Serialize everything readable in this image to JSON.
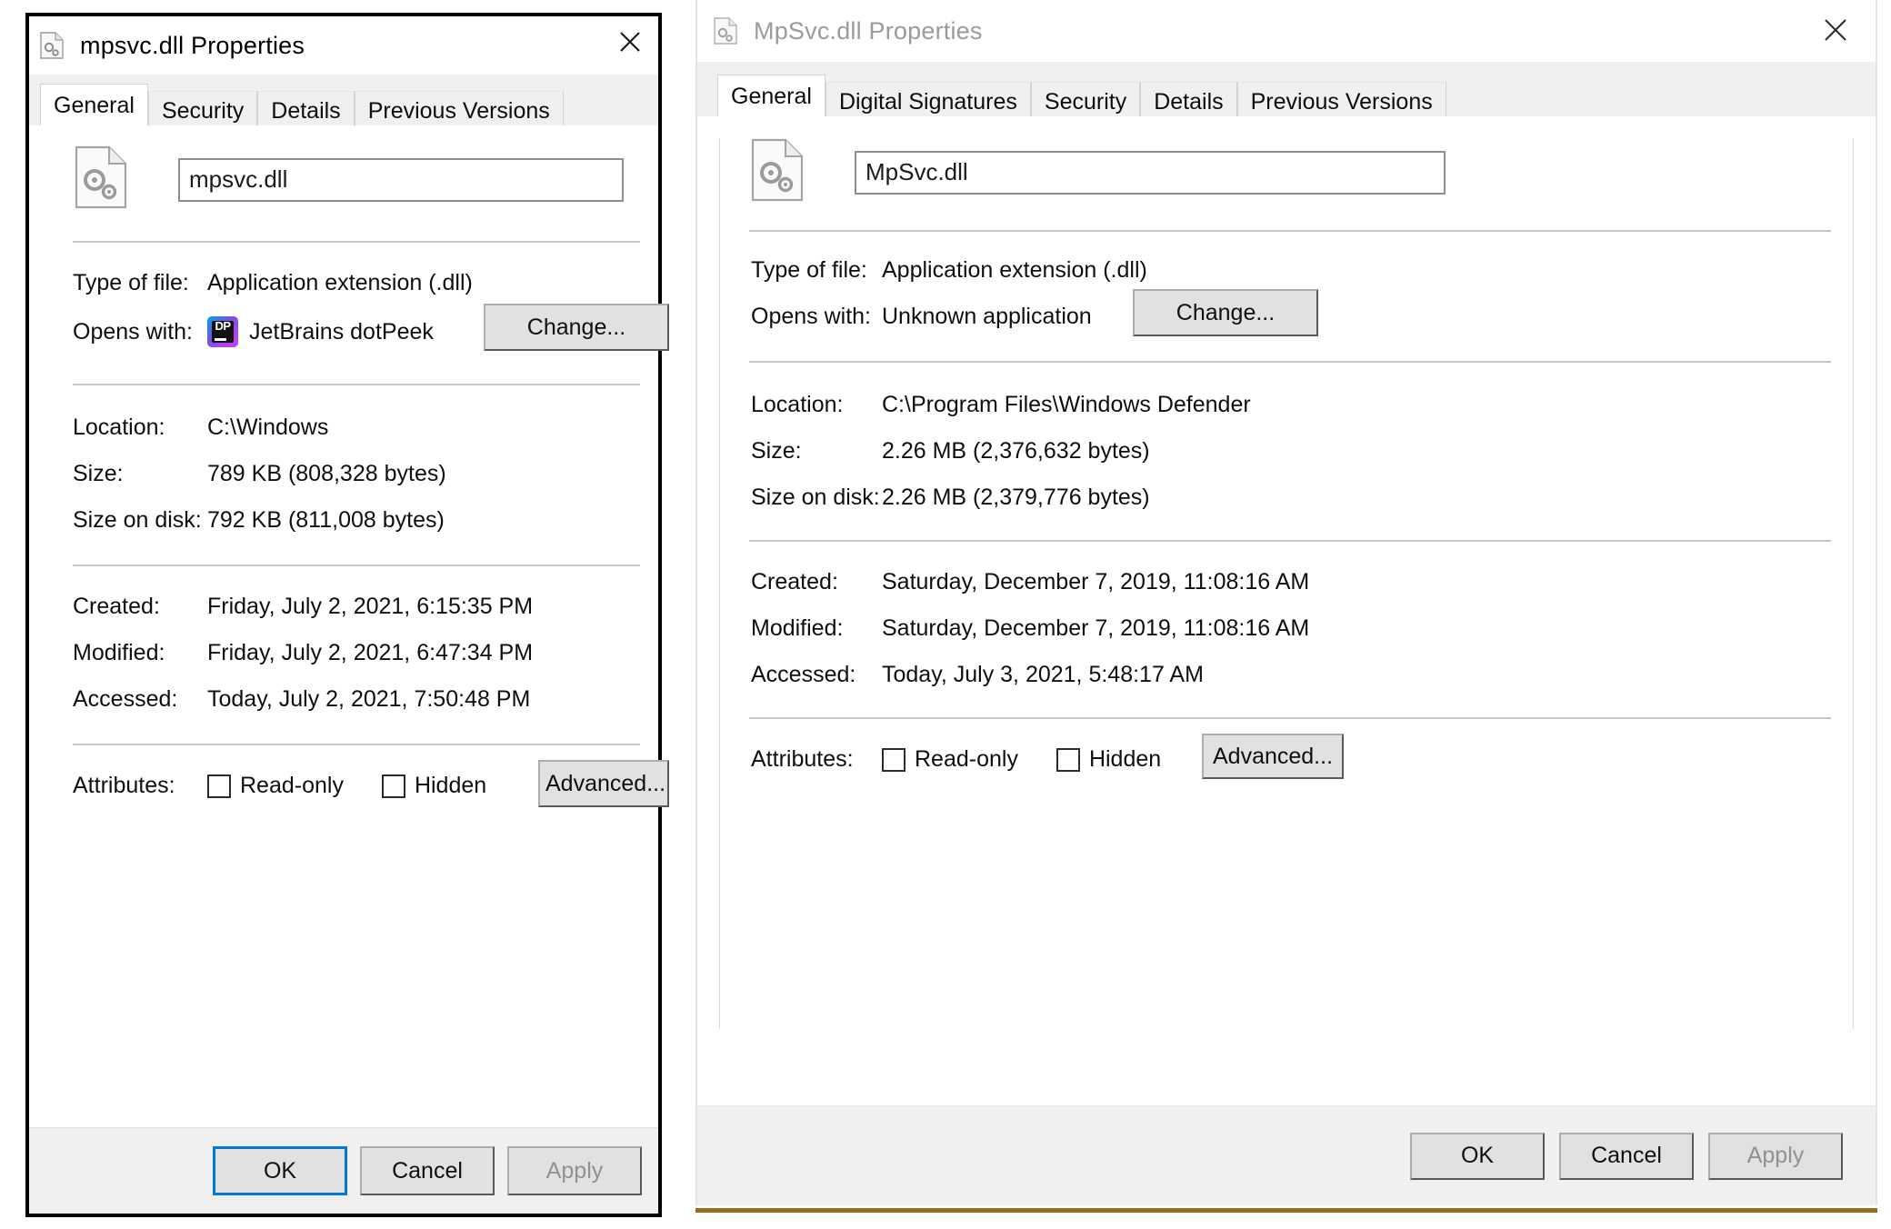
{
  "left_dialog": {
    "title": "mpsvc.dll Properties",
    "window_icon": "dll-file-icon",
    "close_icon": "close-icon",
    "tabs": [
      {
        "label": "General",
        "active": true
      },
      {
        "label": "Security",
        "active": false
      },
      {
        "label": "Details",
        "active": false
      },
      {
        "label": "Previous Versions",
        "active": false
      }
    ],
    "file_icon": "dll-file-icon",
    "filename_value": "mpsvc.dll",
    "rows": [
      {
        "label": "Type of file:",
        "value": "Application extension (.dll)"
      },
      {
        "label": "Opens with:",
        "value": "JetBrains dotPeek",
        "icon": "dotpeek-icon"
      },
      {
        "label": "Location:",
        "value": "C:\\Windows"
      },
      {
        "label": "Size:",
        "value": "789 KB (808,328 bytes)"
      },
      {
        "label": "Size on disk:",
        "value": "792 KB (811,008 bytes)"
      },
      {
        "label": "Created:",
        "value": "Friday, July 2, 2021, 6:15:35 PM"
      },
      {
        "label": "Modified:",
        "value": "Friday, July 2, 2021, 6:47:34 PM"
      },
      {
        "label": "Accessed:",
        "value": "Today, July 2, 2021, 7:50:48 PM"
      }
    ],
    "change_button": "Change...",
    "attributes_label": "Attributes:",
    "readonly_label": "Read-only",
    "readonly_checked": false,
    "hidden_label": "Hidden",
    "hidden_checked": false,
    "advanced_button": "Advanced...",
    "ok_button": "OK",
    "cancel_button": "Cancel",
    "apply_button": "Apply",
    "apply_disabled": true,
    "ok_focused": true
  },
  "right_dialog": {
    "title": "MpSvc.dll Properties",
    "title_inactive": true,
    "window_icon": "dll-file-icon",
    "close_icon": "close-icon",
    "tabs": [
      {
        "label": "General",
        "active": true
      },
      {
        "label": "Digital Signatures",
        "active": false
      },
      {
        "label": "Security",
        "active": false
      },
      {
        "label": "Details",
        "active": false
      },
      {
        "label": "Previous Versions",
        "active": false
      }
    ],
    "file_icon": "dll-file-icon",
    "filename_value": "MpSvc.dll",
    "rows": [
      {
        "label": "Type of file:",
        "value": "Application extension (.dll)"
      },
      {
        "label": "Opens with:",
        "value": "Unknown application"
      },
      {
        "label": "Location:",
        "value": "C:\\Program Files\\Windows Defender"
      },
      {
        "label": "Size:",
        "value": "2.26 MB (2,376,632 bytes)"
      },
      {
        "label": "Size on disk:",
        "value": "2.26 MB (2,379,776 bytes)"
      },
      {
        "label": "Created:",
        "value": "Saturday, December 7, 2019, 11:08:16 AM"
      },
      {
        "label": "Modified:",
        "value": "Saturday, December 7, 2019, 11:08:16 AM"
      },
      {
        "label": "Accessed:",
        "value": "Today, July 3, 2021, 5:48:17 AM"
      }
    ],
    "change_button": "Change...",
    "attributes_label": "Attributes:",
    "readonly_label": "Read-only",
    "readonly_checked": false,
    "hidden_label": "Hidden",
    "hidden_checked": false,
    "advanced_button": "Advanced...",
    "ok_button": "OK",
    "cancel_button": "Cancel",
    "apply_button": "Apply",
    "apply_disabled": true,
    "ok_focused": false
  },
  "colors": {
    "accent_focus": "#0078d7",
    "bottom_accent": "#9a6a1c",
    "dialog_face": "#f0f0f0",
    "text": "#0f0f0f",
    "inactive_title": "#9b9b9b"
  }
}
